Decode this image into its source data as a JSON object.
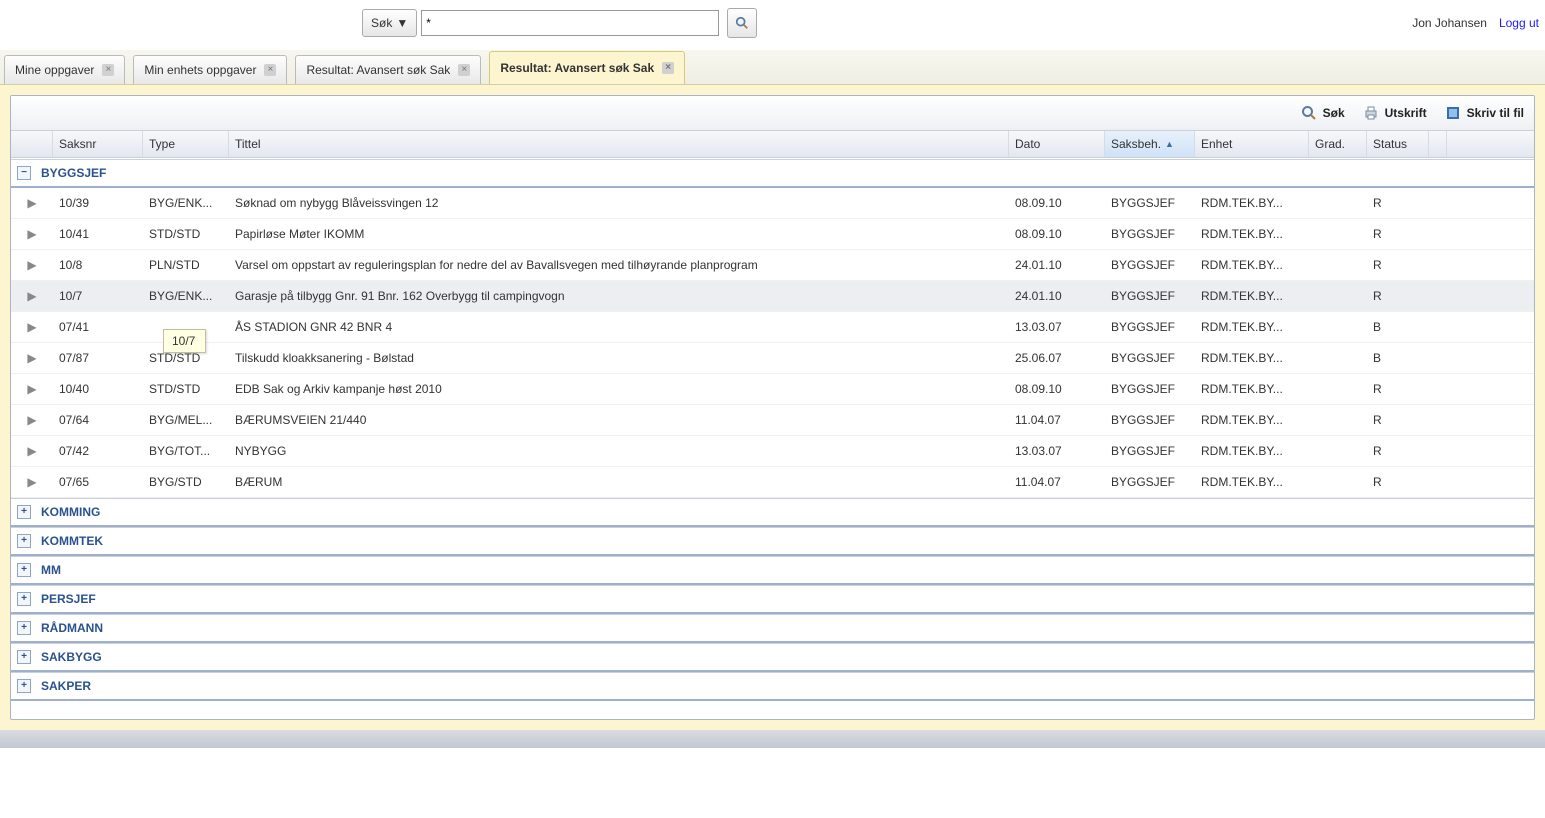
{
  "topbar": {
    "sok_dd": "Søk",
    "search_value": "*",
    "user": "Jon Johansen",
    "logout": "Logg ut"
  },
  "tabs": [
    {
      "label": "Mine oppgaver",
      "active": false
    },
    {
      "label": "Min enhets oppgaver",
      "active": false
    },
    {
      "label": "Resultat: Avansert søk Sak",
      "active": false
    },
    {
      "label": "Resultat: Avansert søk Sak",
      "active": true
    }
  ],
  "toolbar": {
    "sok": "Søk",
    "utskrift": "Utskrift",
    "skriv_til_fil": "Skriv til fil"
  },
  "columns": {
    "saksnr": "Saksnr",
    "type": "Type",
    "tittel": "Tittel",
    "dato": "Dato",
    "saksbeh": "Saksbeh.",
    "enhet": "Enhet",
    "grad": "Grad.",
    "status": "Status"
  },
  "tooltip": "10/7",
  "groups": [
    {
      "name": "BYGGSJEF",
      "expanded": true,
      "rows": [
        {
          "saksnr": "10/39",
          "type": "BYG/ENK...",
          "tittel": "Søknad om nybygg Blåveissvingen 12",
          "dato": "08.09.10",
          "saksbeh": "BYGGSJEF",
          "enhet": "RDM.TEK.BY...",
          "grad": "",
          "status": "R",
          "hover": false
        },
        {
          "saksnr": "10/41",
          "type": "STD/STD",
          "tittel": "Papirløse Møter IKOMM",
          "dato": "08.09.10",
          "saksbeh": "BYGGSJEF",
          "enhet": "RDM.TEK.BY...",
          "grad": "",
          "status": "R",
          "hover": false
        },
        {
          "saksnr": "10/8",
          "type": "PLN/STD",
          "tittel": "Varsel om oppstart av reguleringsplan for nedre del av Bavallsvegen med tilhøyrande planprogram",
          "dato": "24.01.10",
          "saksbeh": "BYGGSJEF",
          "enhet": "RDM.TEK.BY...",
          "grad": "",
          "status": "R",
          "hover": false
        },
        {
          "saksnr": "10/7",
          "type": "BYG/ENK...",
          "tittel": "Garasje på tilbygg Gnr. 91 Bnr. 162 Overbygg til campingvogn",
          "dato": "24.01.10",
          "saksbeh": "BYGGSJEF",
          "enhet": "RDM.TEK.BY...",
          "grad": "",
          "status": "R",
          "hover": true
        },
        {
          "saksnr": "07/41",
          "type": "",
          "tittel": "ÅS STADION GNR 42 BNR 4",
          "dato": "13.03.07",
          "saksbeh": "BYGGSJEF",
          "enhet": "RDM.TEK.BY...",
          "grad": "",
          "status": "B",
          "hover": false
        },
        {
          "saksnr": "07/87",
          "type": "STD/STD",
          "tittel": "Tilskudd kloakksanering - Bølstad",
          "dato": "25.06.07",
          "saksbeh": "BYGGSJEF",
          "enhet": "RDM.TEK.BY...",
          "grad": "",
          "status": "B",
          "hover": false
        },
        {
          "saksnr": "10/40",
          "type": "STD/STD",
          "tittel": "EDB Sak og Arkiv kampanje høst 2010",
          "dato": "08.09.10",
          "saksbeh": "BYGGSJEF",
          "enhet": "RDM.TEK.BY...",
          "grad": "",
          "status": "R",
          "hover": false
        },
        {
          "saksnr": "07/64",
          "type": "BYG/MEL...",
          "tittel": "BÆRUMSVEIEN 21/440",
          "dato": "11.04.07",
          "saksbeh": "BYGGSJEF",
          "enhet": "RDM.TEK.BY...",
          "grad": "",
          "status": "R",
          "hover": false
        },
        {
          "saksnr": "07/42",
          "type": "BYG/TOT...",
          "tittel": "NYBYGG",
          "dato": "13.03.07",
          "saksbeh": "BYGGSJEF",
          "enhet": "RDM.TEK.BY...",
          "grad": "",
          "status": "R",
          "hover": false
        },
        {
          "saksnr": "07/65",
          "type": "BYG/STD",
          "tittel": "BÆRUM",
          "dato": "11.04.07",
          "saksbeh": "BYGGSJEF",
          "enhet": "RDM.TEK.BY...",
          "grad": "",
          "status": "R",
          "hover": false
        }
      ]
    },
    {
      "name": "KOMMING",
      "expanded": false,
      "rows": []
    },
    {
      "name": "KOMMTEK",
      "expanded": false,
      "rows": []
    },
    {
      "name": "MM",
      "expanded": false,
      "rows": []
    },
    {
      "name": "PERSJEF",
      "expanded": false,
      "rows": []
    },
    {
      "name": "RÅDMANN",
      "expanded": false,
      "rows": []
    },
    {
      "name": "SAKBYGG",
      "expanded": false,
      "rows": []
    },
    {
      "name": "SAKPER",
      "expanded": false,
      "rows": []
    }
  ]
}
